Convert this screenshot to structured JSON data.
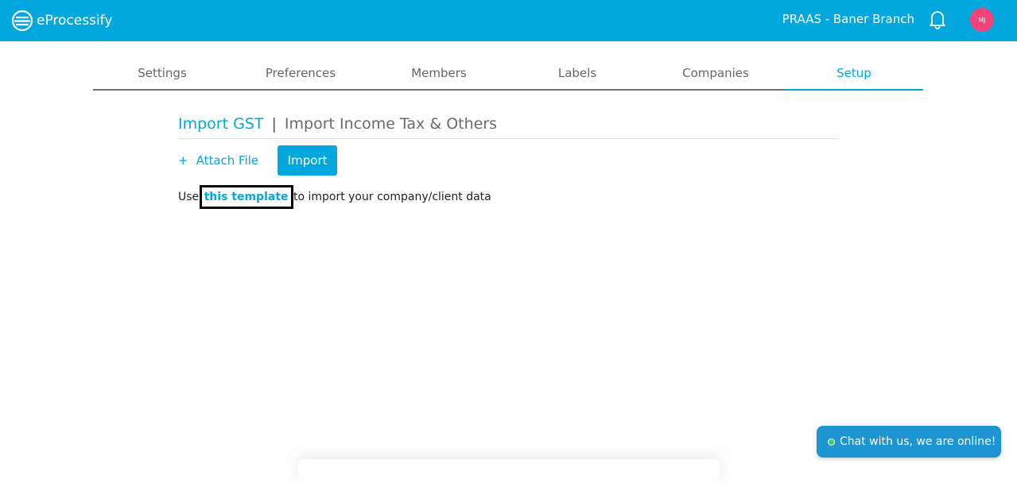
{
  "app": {
    "brand": "eProcessify",
    "branch": "PRAAS - Baner Branch",
    "avatar_initials": "MJ"
  },
  "tabs": [
    {
      "label": "Settings"
    },
    {
      "label": "Preferences"
    },
    {
      "label": "Members"
    },
    {
      "label": "Labels"
    },
    {
      "label": "Companies"
    },
    {
      "label": "Setup",
      "active": true
    }
  ],
  "section": {
    "active": "Import GST",
    "separator": "|",
    "other": "Import Income Tax & Others"
  },
  "actions": {
    "attach_plus": "+",
    "attach_label": "Attach File",
    "import_label": "Import"
  },
  "template": {
    "prefix": "Use ",
    "link": "this template",
    "suffix": " to import your company/client data"
  },
  "chat": {
    "label": "Chat with us, we are online!"
  },
  "colors": {
    "accent": "#02a8dd",
    "avatar": "#f2447a",
    "chat": "#1e95d3",
    "online": "#4ccd5b"
  },
  "icons": {
    "logo": "eprocessify-logo-icon",
    "bell": "bell-icon",
    "online": "online-dot-icon"
  }
}
